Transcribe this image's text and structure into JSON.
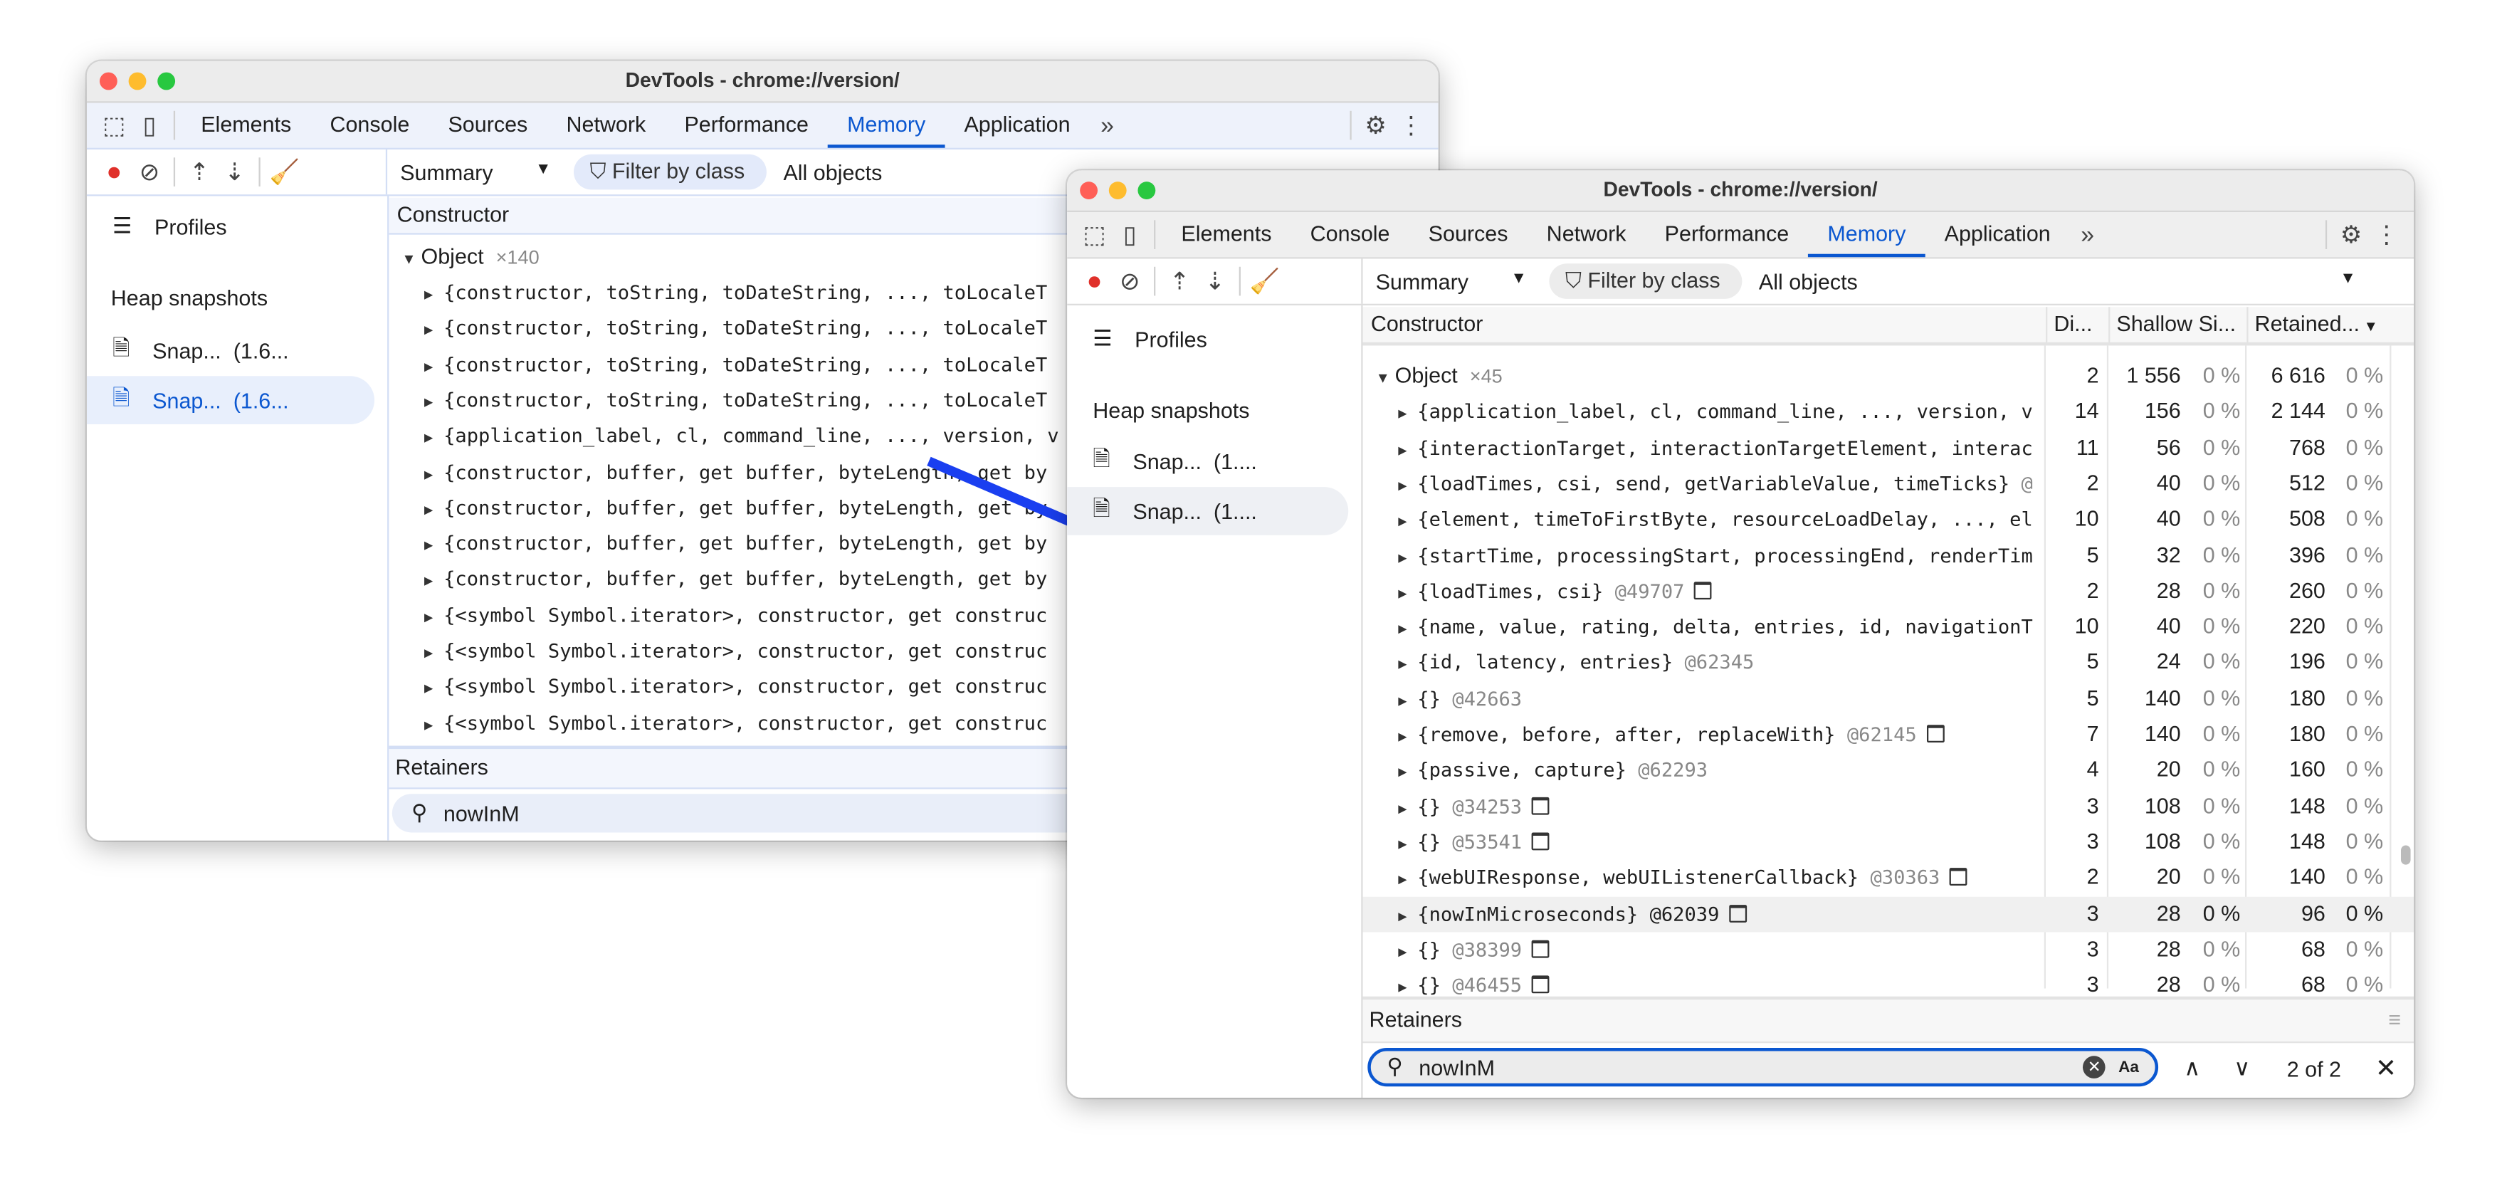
{
  "colors": {
    "accent": "#0b57d0",
    "arrow": "#1a3ff0",
    "close": "#ff5f57",
    "minimize": "#febc2e",
    "zoom": "#28c840",
    "record": "#e0302a"
  },
  "back": {
    "title": "DevTools - chrome://version/",
    "tabs": [
      "Elements",
      "Console",
      "Sources",
      "Network",
      "Performance",
      "Memory",
      "Application"
    ],
    "active_tab": "Memory",
    "view_select": "Summary",
    "filter_placeholder": "Filter by class",
    "objects_select": "All objects",
    "sidebar": {
      "profiles": "Profiles",
      "heap_snapshots": "Heap snapshots",
      "snapshots": [
        {
          "name": "Snap...",
          "size": "(1.6..."
        },
        {
          "name": "Snap...",
          "size": "(1.6..."
        }
      ]
    },
    "constructor_header": "Constructor",
    "group": {
      "name": "Object",
      "count": "×140"
    },
    "rows": [
      "{constructor, toString, toDateString, ..., toLocaleT",
      "{constructor, toString, toDateString, ..., toLocaleT",
      "{constructor, toString, toDateString, ..., toLocaleT",
      "{constructor, toString, toDateString, ..., toLocaleT",
      "{application_label, cl, command_line, ..., version, v",
      "{constructor, buffer, get buffer, byteLength, get by",
      "{constructor, buffer, get buffer, byteLength, get by",
      "{constructor, buffer, get buffer, byteLength, get by",
      "{constructor, buffer, get buffer, byteLength, get by",
      "{<symbol Symbol.iterator>, constructor, get construc",
      "{<symbol Symbol.iterator>, constructor, get construc",
      "{<symbol Symbol.iterator>, constructor, get construc",
      "{<symbol Symbol.iterator>, constructor, get construc"
    ],
    "retainers_header": "Retainers",
    "search_value": "nowInM"
  },
  "front": {
    "title": "DevTools - chrome://version/",
    "tabs": [
      "Elements",
      "Console",
      "Sources",
      "Network",
      "Performance",
      "Memory",
      "Application"
    ],
    "active_tab": "Memory",
    "view_select": "Summary",
    "filter_placeholder": "Filter by class",
    "objects_select": "All objects",
    "sidebar": {
      "profiles": "Profiles",
      "heap_snapshots": "Heap snapshots",
      "snapshots": [
        {
          "name": "Snap...",
          "size": "(1...."
        },
        {
          "name": "Snap...",
          "size": "(1...."
        }
      ]
    },
    "columns": {
      "constructor": "Constructor",
      "distance": "Di...",
      "shallow": "Shallow Si...",
      "retained": "Retained..."
    },
    "group": {
      "name": "Object",
      "count": "×45",
      "distance": "2",
      "shallow": "1 556",
      "shallow_pct": "0 %",
      "retained": "6 616",
      "retained_pct": "0 %"
    },
    "rows": [
      {
        "text": "{application_label, cl, command_line, ..., version, v",
        "id": "",
        "window": false,
        "distance": "14",
        "shallow": "156",
        "shallow_pct": "0 %",
        "retained": "2 144",
        "retained_pct": "0 %"
      },
      {
        "text": "{interactionTarget, interactionTargetElement, interac",
        "id": "",
        "window": false,
        "distance": "11",
        "shallow": "56",
        "shallow_pct": "0 %",
        "retained": "768",
        "retained_pct": "0 %"
      },
      {
        "text": "{loadTimes, csi, send, getVariableValue, timeTicks}",
        "id": "@",
        "window": false,
        "distance": "2",
        "shallow": "40",
        "shallow_pct": "0 %",
        "retained": "512",
        "retained_pct": "0 %"
      },
      {
        "text": "{element, timeToFirstByte, resourceLoadDelay, ..., el",
        "id": "",
        "window": false,
        "distance": "10",
        "shallow": "40",
        "shallow_pct": "0 %",
        "retained": "508",
        "retained_pct": "0 %"
      },
      {
        "text": "{startTime, processingStart, processingEnd, renderTim",
        "id": "",
        "window": false,
        "distance": "5",
        "shallow": "32",
        "shallow_pct": "0 %",
        "retained": "396",
        "retained_pct": "0 %"
      },
      {
        "text": "{loadTimes, csi}",
        "id": "@49707",
        "window": true,
        "distance": "2",
        "shallow": "28",
        "shallow_pct": "0 %",
        "retained": "260",
        "retained_pct": "0 %"
      },
      {
        "text": "{name, value, rating, delta, entries, id, navigationT",
        "id": "",
        "window": false,
        "distance": "10",
        "shallow": "40",
        "shallow_pct": "0 %",
        "retained": "220",
        "retained_pct": "0 %"
      },
      {
        "text": "{id, latency, entries}",
        "id": "@62345",
        "window": false,
        "distance": "5",
        "shallow": "24",
        "shallow_pct": "0 %",
        "retained": "196",
        "retained_pct": "0 %"
      },
      {
        "text": "{}",
        "id": "@42663",
        "window": false,
        "distance": "5",
        "shallow": "140",
        "shallow_pct": "0 %",
        "retained": "180",
        "retained_pct": "0 %"
      },
      {
        "text": "{remove, before, after, replaceWith}",
        "id": "@62145",
        "window": true,
        "distance": "7",
        "shallow": "140",
        "shallow_pct": "0 %",
        "retained": "180",
        "retained_pct": "0 %"
      },
      {
        "text": "{passive, capture}",
        "id": "@62293",
        "window": false,
        "distance": "4",
        "shallow": "20",
        "shallow_pct": "0 %",
        "retained": "160",
        "retained_pct": "0 %"
      },
      {
        "text": "{}",
        "id": "@34253",
        "window": true,
        "distance": "3",
        "shallow": "108",
        "shallow_pct": "0 %",
        "retained": "148",
        "retained_pct": "0 %"
      },
      {
        "text": "{}",
        "id": "@53541",
        "window": true,
        "distance": "3",
        "shallow": "108",
        "shallow_pct": "0 %",
        "retained": "148",
        "retained_pct": "0 %"
      },
      {
        "text": "{webUIResponse, webUIListenerCallback}",
        "id": "@30363",
        "window": true,
        "distance": "2",
        "shallow": "20",
        "shallow_pct": "0 %",
        "retained": "140",
        "retained_pct": "0 %"
      },
      {
        "text": "{nowInMicroseconds}",
        "id": "@62039",
        "window": true,
        "selected": true,
        "distance": "3",
        "shallow": "28",
        "shallow_pct": "0 %",
        "retained": "96",
        "retained_pct": "0 %"
      },
      {
        "text": "{}",
        "id": "@38399",
        "window": true,
        "distance": "3",
        "shallow": "28",
        "shallow_pct": "0 %",
        "retained": "68",
        "retained_pct": "0 %"
      },
      {
        "text": "{}",
        "id": "@46455",
        "window": true,
        "distance": "3",
        "shallow": "28",
        "shallow_pct": "0 %",
        "retained": "68",
        "retained_pct": "0 %"
      }
    ],
    "retainers_header": "Retainers",
    "search_value": "nowInM",
    "match_case_label": "Aa",
    "match_count": "2 of 2"
  }
}
